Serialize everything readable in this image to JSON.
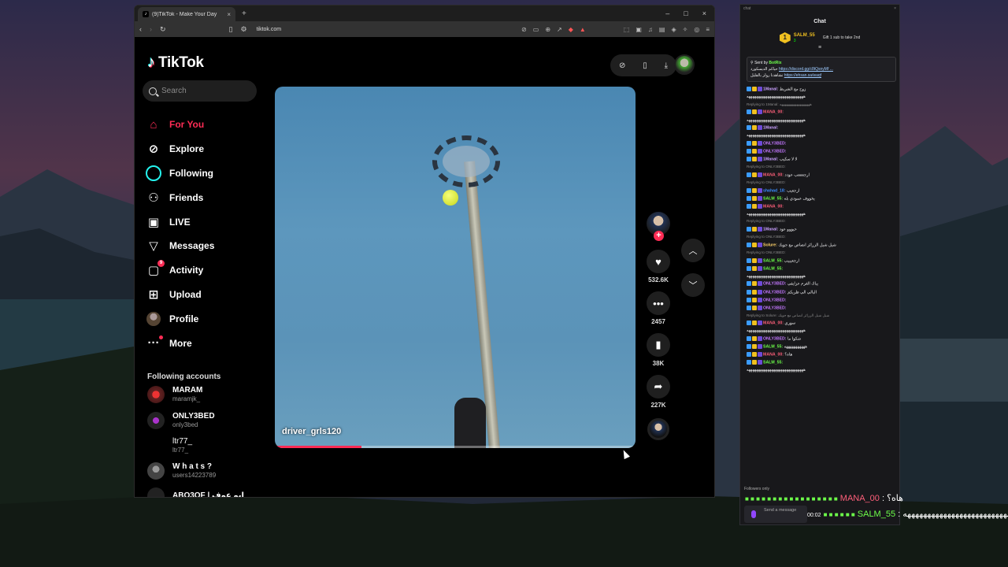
{
  "browser": {
    "tab_title": "(9)TikTok - Make Your Day",
    "tab_close": "×",
    "new_tab": "+",
    "url": "tiktok.com",
    "window_controls": [
      "–",
      "□",
      "×"
    ]
  },
  "tiktok": {
    "logo_text": "TikTok",
    "search_placeholder": "Search",
    "nav": [
      {
        "label": "For You",
        "icon": "home-icon",
        "active": true
      },
      {
        "label": "Explore",
        "icon": "compass-icon"
      },
      {
        "label": "Following",
        "icon": "following-icon"
      },
      {
        "label": "Friends",
        "icon": "friends-icon"
      },
      {
        "label": "LIVE",
        "icon": "live-icon"
      },
      {
        "label": "Messages",
        "icon": "messages-icon"
      },
      {
        "label": "Activity",
        "icon": "activity-icon",
        "badge": "9"
      },
      {
        "label": "Upload",
        "icon": "upload-icon"
      },
      {
        "label": "Profile",
        "icon": "profile-icon"
      },
      {
        "label": "More",
        "icon": "more-icon"
      }
    ],
    "following_title": "Following accounts",
    "accounts": [
      {
        "name": "MARAM",
        "handle": "maramjk_"
      },
      {
        "name": "ONLY3BED",
        "handle": "only3bed"
      },
      {
        "name": "ltr77_",
        "handle": "ltr77_"
      },
      {
        "name": "W h a t s ?",
        "handle": "users14223789"
      },
      {
        "name": "ABO3OF | ابو عوف",
        "handle": ""
      }
    ],
    "video": {
      "username": "driver_grls120",
      "progress": 0.24
    },
    "actions": {
      "likes": "532.6K",
      "comments": "2457",
      "saves": "38K",
      "shares": "227K"
    }
  },
  "chat": {
    "mini_header": "chat",
    "title": "Chat",
    "leader_rank": "1",
    "leader_name": "SALM_55",
    "leader_subs": "3",
    "leader_gift": "Gift 1 sub to take 2nd",
    "pinned_label": "Sent by",
    "pinned_by": "BotRix",
    "pinned_line1_text": "حياكم الديسكورد",
    "pinned_line1_link": "https://discord.gg/c8tQsnyMf ...",
    "pinned_line2_text": "تشاهدنا رولز بالقليل",
    "pinned_line2_link": "https://ehsan.sa/waqf",
    "messages": [
      {
        "reply": "",
        "user": "1Manal:",
        "color": "#c9a0ff",
        "text": "زوج مع الشريط"
      },
      {
        "reply": "",
        "user": "",
        "color": "#fff",
        "text": "ههههههههههههههههههههههههههههههه"
      },
      {
        "reply": "Replying to 1Manal: ههههههههههههههههههه",
        "user": "MANA_00:",
        "color": "#ff5f7a",
        "text": ""
      },
      {
        "reply": "",
        "user": "",
        "color": "#fff",
        "text": "ههههههههههههههههههههههههههههههه"
      },
      {
        "reply": "",
        "user": "1Manal:",
        "color": "#c9a0ff",
        "text": ""
      },
      {
        "reply": "",
        "user": "",
        "color": "#fff",
        "text": "ههههههههههههههههههههههههههههههه"
      },
      {
        "reply": "",
        "user": "ONLY3BED:",
        "color": "#c377ff",
        "text": ""
      },
      {
        "reply": "",
        "user": "ONLY3BED:",
        "color": "#c377ff",
        "text": ""
      },
      {
        "reply": "",
        "user": "1Manal:",
        "color": "#c9a0ff",
        "text": "لا لا سكيب"
      },
      {
        "reply": "Replying to ONLY3BED:",
        "user": "MANA_00:",
        "color": "#ff5f7a",
        "text": "ارجعععب عودد"
      },
      {
        "reply": "Replying to ONLY3BED:",
        "user": "shahad_18:",
        "color": "#3b8cff",
        "text": "ارجعيب"
      },
      {
        "reply": "",
        "user": "SALM_55:",
        "color": "#6dff4a",
        "text": "يخووف عمودي بله"
      },
      {
        "reply": "",
        "user": "MANA_00:",
        "color": "#ff5f7a",
        "text": ""
      },
      {
        "reply": "",
        "user": "",
        "color": "#fff",
        "text": "ههههههههههههههههههههههههههههههه"
      },
      {
        "reply": "Replying to ONLY3BED:",
        "user": "1Manal:",
        "color": "#c9a0ff",
        "text": "حيووو عود"
      },
      {
        "reply": "Replying to ONLY3BED:",
        "user": "Solure:",
        "color": "#ffd36a",
        "text": "شيل شيل الزرائز انصاص مع جويك"
      },
      {
        "reply": "Replying to ONLY3BED:",
        "user": "SALM_55:",
        "color": "#6dff4a",
        "text": "ارجعيييب"
      },
      {
        "reply": "",
        "user": "SALM_55:",
        "color": "#6dff4a",
        "text": ""
      },
      {
        "reply": "",
        "user": "",
        "color": "#fff",
        "text": "ههههههههههههههههههههههههههههههه"
      },
      {
        "reply": "",
        "user": "ONLY3BED:",
        "color": "#c377ff",
        "text": "يباك الغرم عزايفي"
      },
      {
        "reply": "",
        "user": "ONLY3BED:",
        "color": "#c377ff",
        "text": "البالي الي ظريكم"
      },
      {
        "reply": "",
        "user": "ONLY3BED:",
        "color": "#c377ff",
        "text": ""
      },
      {
        "reply": "",
        "user": "ONLY3BED:",
        "color": "#c377ff",
        "text": ""
      },
      {
        "reply": "Replying to Solure: شيل شيل الزرائز انصاص مع جويك",
        "user": "MANA_00:",
        "color": "#ff5f7a",
        "text": "سوري"
      },
      {
        "reply": "",
        "user": "",
        "color": "#fff",
        "text": "ههههههههههههههههههههههههههههههه"
      },
      {
        "reply": "",
        "user": "ONLY3BED:",
        "color": "#c377ff",
        "text": "شكوا ما"
      },
      {
        "reply": "",
        "user": "SALM_55:",
        "color": "#6dff4a",
        "text": "هههههههههههه"
      },
      {
        "reply": "",
        "user": "MANA_00:",
        "color": "#ff5f7a",
        "text": "هاه؟"
      },
      {
        "reply": "",
        "user": "SALM_55:",
        "color": "#6dff4a",
        "text": ""
      },
      {
        "reply": "",
        "user": "",
        "color": "#fff",
        "text": "ههههههههههههههههههههههههههههههه"
      }
    ],
    "followers_only": "Followers only",
    "send_placeholder": "Send a message"
  },
  "overlay": {
    "line1_user": "MANA_00",
    "line1_text": ": هاه؟",
    "line2_time": "00:02",
    "line2_user": "SALM_55",
    "line2_text": ": ههههههههههههههههههههههههههههه"
  }
}
